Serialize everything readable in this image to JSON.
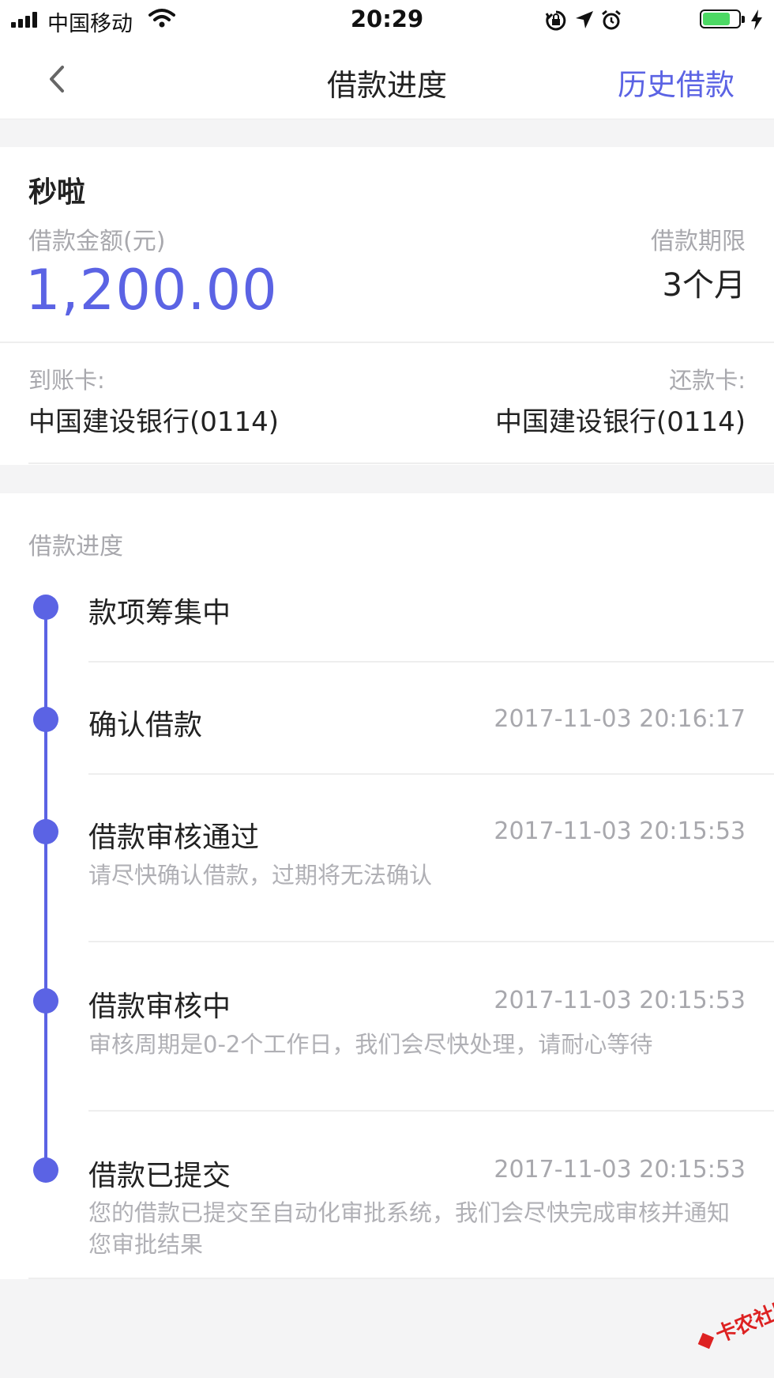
{
  "status_bar": {
    "carrier": "中国移动",
    "time": "20:29",
    "battery_level": 0.8
  },
  "nav": {
    "title": "借款进度",
    "right_label": "历史借款"
  },
  "loan": {
    "product": "秒啦",
    "amount_label": "借款金额(元)",
    "amount": "1,200.00",
    "term_label": "借款期限",
    "term": "3个月",
    "receive_card_label": "到账卡:",
    "receive_card": "中国建设银行(0114)",
    "repay_card_label": "还款卡:",
    "repay_card": "中国建设银行(0114)"
  },
  "progress": {
    "title": "借款进度",
    "steps": [
      {
        "title": "款项筹集中",
        "time": "",
        "desc": ""
      },
      {
        "title": "确认借款",
        "time": "2017-11-03 20:16:17",
        "desc": ""
      },
      {
        "title": "借款审核通过",
        "time": "2017-11-03 20:15:53",
        "desc": "请尽快确认借款，过期将无法确认"
      },
      {
        "title": "借款审核中",
        "time": "2017-11-03 20:15:53",
        "desc": "审核周期是0-2个工作日，我们会尽快处理，请耐心等待"
      },
      {
        "title": "借款已提交",
        "time": "2017-11-03 20:15:53",
        "desc": "您的借款已提交至自动化审批系统，我们会尽快完成审核并通知您审批结果"
      }
    ]
  },
  "watermark": "卡农社区",
  "colors": {
    "accent": "#5b63e4",
    "muted": "#a8a8ad",
    "battery": "#4cd964"
  }
}
